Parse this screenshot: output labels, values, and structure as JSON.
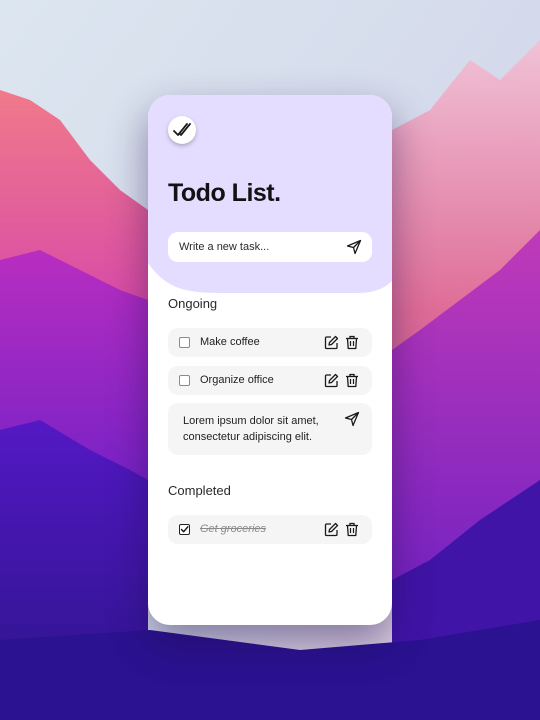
{
  "app": {
    "title": "Todo List."
  },
  "new_task": {
    "placeholder": "Write a new task...",
    "value": ""
  },
  "sections": {
    "ongoing": {
      "heading": "Ongoing",
      "tasks": [
        {
          "label": "Make coffee",
          "done": false
        },
        {
          "label": "Organize office",
          "done": false
        }
      ],
      "editing_text": "Lorem ipsum dolor sit amet, consectetur adipiscing elit."
    },
    "completed": {
      "heading": "Completed",
      "tasks": [
        {
          "label": "Get groceries",
          "done": true
        }
      ]
    }
  },
  "icons": {
    "logo": "double-check-icon",
    "send": "paper-plane-icon",
    "edit": "pencil-square-icon",
    "delete": "trash-icon"
  },
  "colors": {
    "header_background": "#e5ddff",
    "card_background": "#ffffff",
    "task_row_background": "#f5f5f5",
    "text_primary": "#121212"
  }
}
